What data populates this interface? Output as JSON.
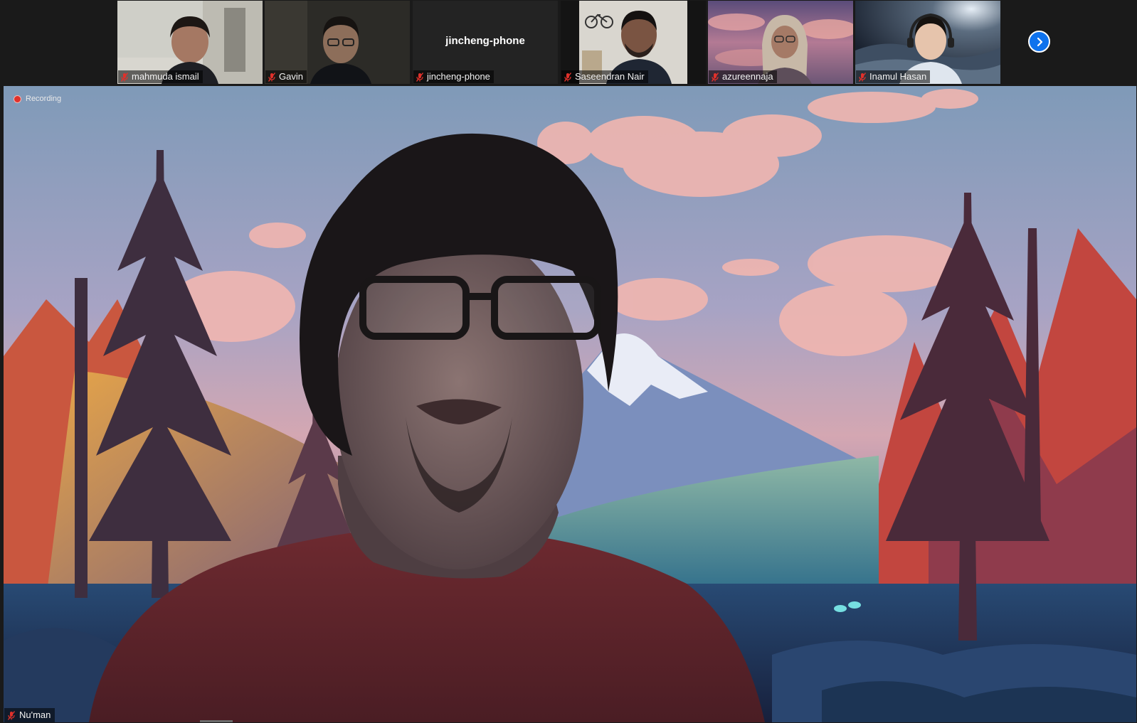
{
  "participants": [
    {
      "name": "mahmuda ismail",
      "video": "webcam",
      "muted": true
    },
    {
      "name": "Gavin",
      "video": "webcam",
      "muted": true
    },
    {
      "name": "jincheng-phone",
      "video": "off",
      "center_label": "jincheng-phone",
      "muted": true
    },
    {
      "name": "Saseendran Nair",
      "video": "webcam",
      "muted": true
    },
    {
      "name": "azureennaja",
      "video": "webcam",
      "muted": true
    },
    {
      "name": "Inamul Hasan",
      "video": "webcam",
      "muted": true
    }
  ],
  "next_page_button": {
    "icon": "chevron-right-icon"
  },
  "recording": {
    "label": "Recording",
    "icon": "record-dot-icon"
  },
  "speaker": {
    "name": "Nu'man",
    "muted": true,
    "background": "landscape-virtual-background"
  },
  "colors": {
    "accent": "#0e72ed",
    "recording": "#e0312b",
    "mute": "#e0312b",
    "background": "#1a1a1a"
  }
}
